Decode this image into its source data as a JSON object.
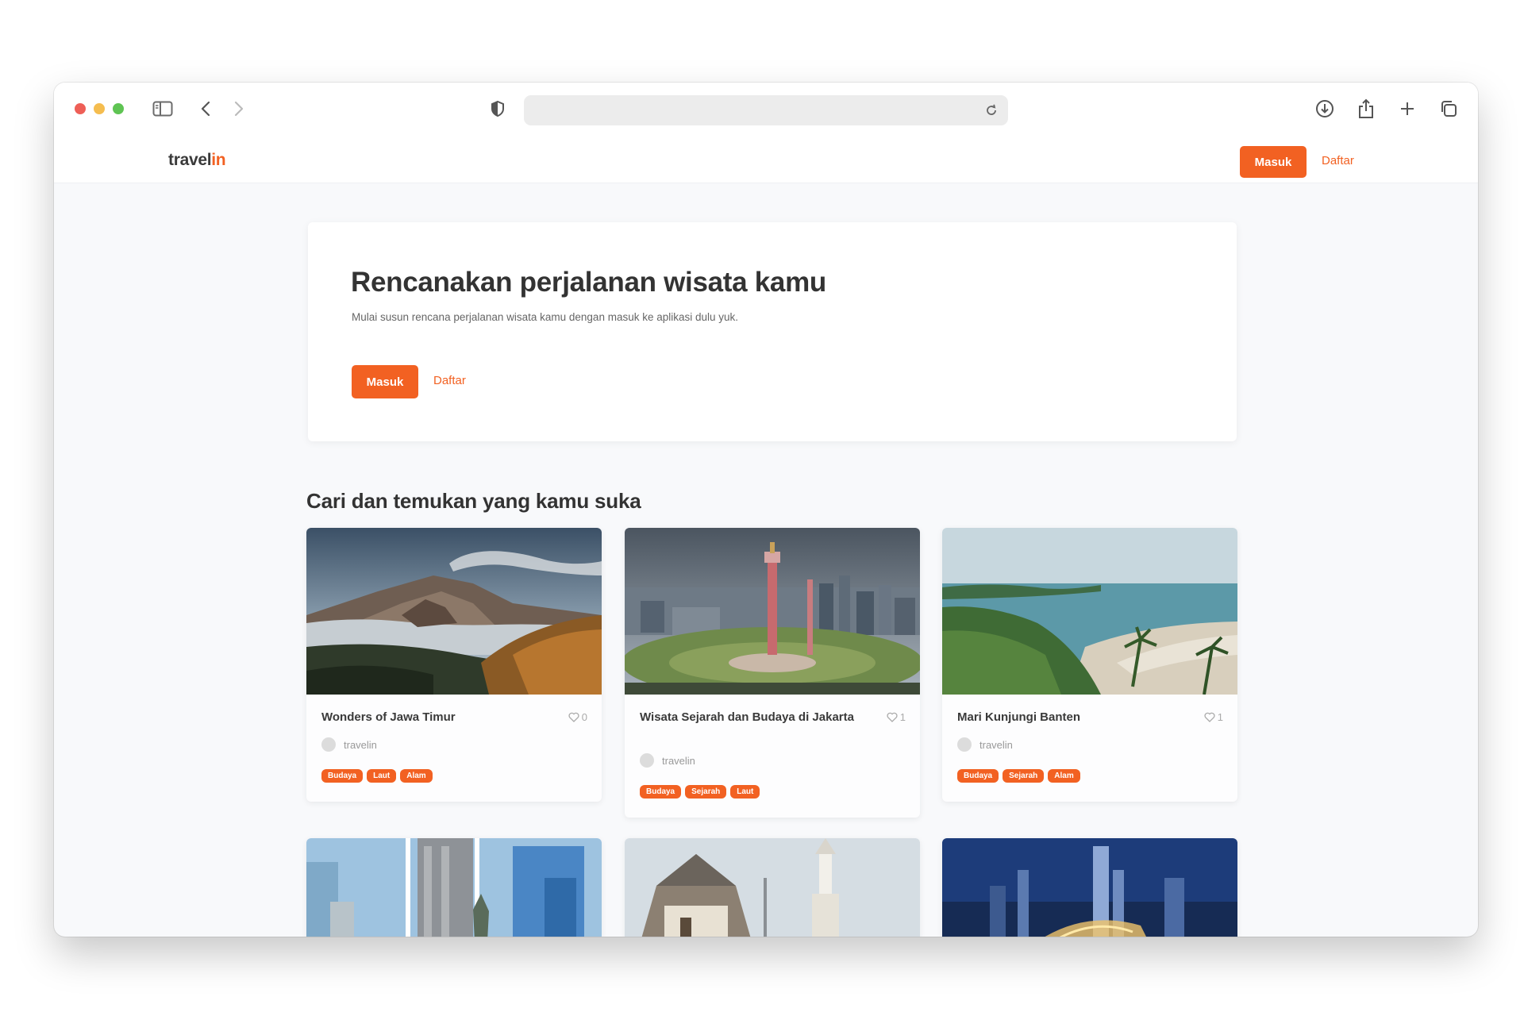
{
  "browser": {
    "traffic_lights": [
      "#ee5f57",
      "#f5bd4f",
      "#5fc453"
    ]
  },
  "site": {
    "logo_part1": "travel",
    "logo_part2": "in",
    "header_login": "Masuk",
    "header_signup": "Daftar"
  },
  "hero": {
    "title": "Rencanakan perjalanan wisata kamu",
    "subtitle": "Mulai susun rencana perjalanan wisata kamu dengan masuk ke aplikasi dulu yuk.",
    "login": "Masuk",
    "signup": "Daftar"
  },
  "section_title": "Cari dan temukan yang kamu suka",
  "cards": [
    {
      "title": "Wonders of Jawa Timur",
      "likes": "0",
      "author": "travelin",
      "tags": [
        "Budaya",
        "Laut",
        "Alam"
      ]
    },
    {
      "title": "Wisata Sejarah dan Budaya di Jakarta",
      "likes": "1",
      "author": "travelin",
      "tags": [
        "Budaya",
        "Sejarah",
        "Laut"
      ]
    },
    {
      "title": "Mari Kunjungi Banten",
      "likes": "1",
      "author": "travelin",
      "tags": [
        "Budaya",
        "Sejarah",
        "Alam"
      ]
    }
  ],
  "colors": {
    "accent": "#f26122",
    "page_bg": "#f8f9fb"
  }
}
